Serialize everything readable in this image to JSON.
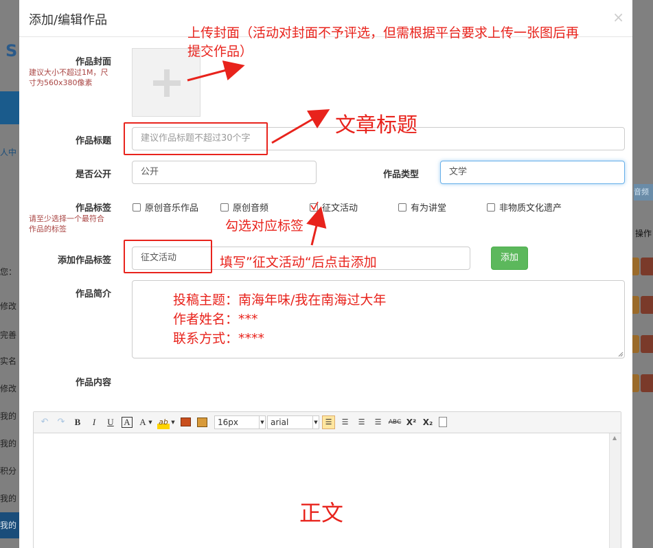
{
  "modal": {
    "title": "添加/编辑作品",
    "close": "×"
  },
  "form": {
    "cover_label": "作品封面",
    "cover_hint": "建议大小不超过1M，尺寸为560x380像素",
    "title_label": "作品标题",
    "title_placeholder": "建议作品标题不超过30个字",
    "public_label": "是否公开",
    "public_value": "公开",
    "type_label": "作品类型",
    "type_value": "文学",
    "tags_label": "作品标签",
    "tags_hint": "请至少选择一个最符合作品的标签",
    "tags": [
      {
        "label": "原创音乐作品",
        "checked": false
      },
      {
        "label": "原创音频",
        "checked": false
      },
      {
        "label": "征文活动",
        "checked": true
      },
      {
        "label": "有为讲堂",
        "checked": false
      },
      {
        "label": "非物质文化遗产",
        "checked": false
      }
    ],
    "add_tag_label": "添加作品标签",
    "add_tag_value": "征文活动",
    "add_button": "添加",
    "intro_label": "作品简介",
    "content_label": "作品内容"
  },
  "editor": {
    "font_size": "16px",
    "font_family": "arial",
    "buttons": {
      "bold": "B",
      "italic": "I",
      "underline": "U",
      "border": "A",
      "font_color": "A",
      "highlight": "ab"
    }
  },
  "annotations": {
    "cover_note": "上传封面（活动对封面不予评选，但需根据平台要求上传一张图后再",
    "cover_note_2": "提交作品）",
    "title_note": "文章标题",
    "tag_note": "勾选对应标签",
    "add_note": "填写”征文活动“后点击添加",
    "intro_line1": "投稿主题：南海年味/我在南海过大年",
    "intro_line2": "作者姓名：***",
    "intro_line3": "联系方式：****",
    "body_note": "正文"
  },
  "background": {
    "left_rows": [
      "人中",
      "您：",
      "修改",
      "完善",
      "实名",
      "修改",
      "我的",
      "我的",
      "积分",
      "我的",
      "我的"
    ],
    "right_tag": "音频",
    "right_op": "操作"
  },
  "colors": {
    "annotation_red": "#e8231c",
    "add_button_green": "#5cb85c",
    "hint_red": "#a94442"
  }
}
